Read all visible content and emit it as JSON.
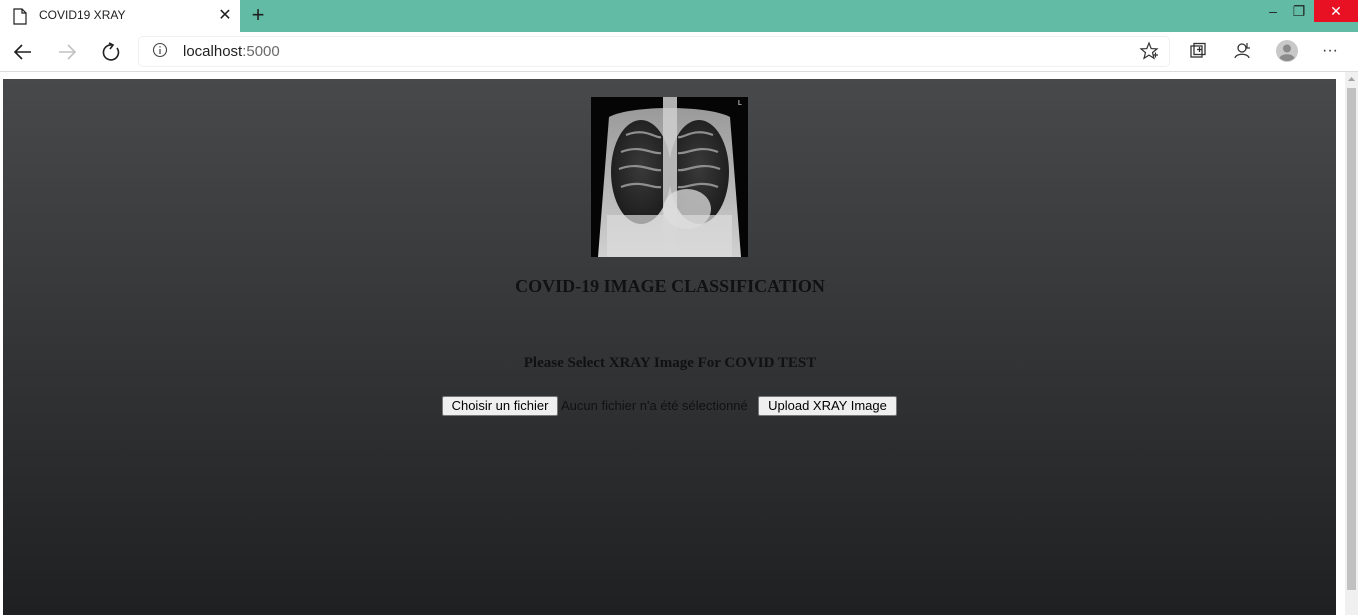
{
  "browser": {
    "tab": {
      "title": "COVID19 XRAY",
      "close_glyph": "✕"
    },
    "new_tab_glyph": "+",
    "window_controls": {
      "minimize": "–",
      "maximize": "❐",
      "close": "✕"
    },
    "address": {
      "host": "localhost",
      "port": ":5000"
    },
    "icons": [
      "back-icon",
      "forward-icon",
      "refresh-icon",
      "info-icon",
      "favorite-star-icon",
      "collections-icon",
      "feedback-icon",
      "profile-avatar",
      "more-menu-icon"
    ],
    "more_glyph": "···",
    "colors": {
      "tabstrip": "#62bba4",
      "close_button": "#e81123"
    }
  },
  "page": {
    "image_alt": "L",
    "title": "COVID-19 IMAGE CLASSIFICATION",
    "subtitle": "Please Select XRAY Image For COVID TEST",
    "file_input": {
      "button_label": "Choisir un fichier",
      "status": "Aucun fichier n'a été sélectionné"
    },
    "upload_button": "Upload XRAY Image",
    "colors": {
      "background_top": "#48494b",
      "background_bottom": "#1e2022"
    }
  }
}
